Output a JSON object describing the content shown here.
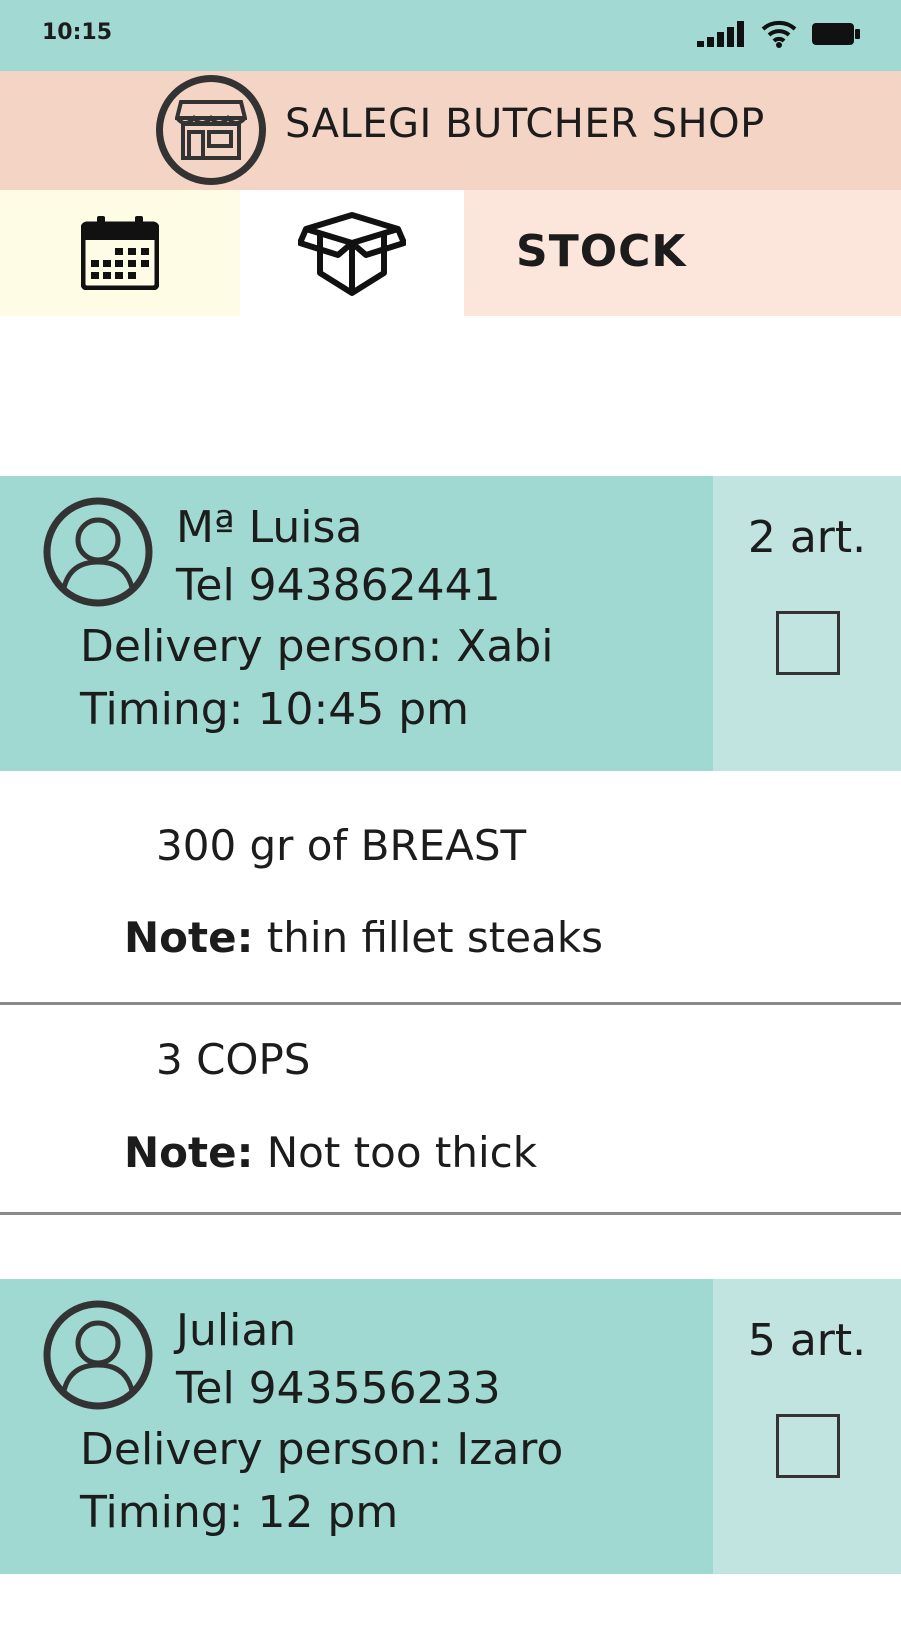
{
  "status_bar": {
    "time": "10:15",
    "icons": [
      "signal-icon",
      "wifi-icon",
      "battery-icon"
    ]
  },
  "header": {
    "title": "SALEGI BUTCHER SHOP",
    "logo_icon": "store-icon"
  },
  "tabs": {
    "calendar_icon": "calendar-icon",
    "box_icon": "box-icon",
    "stock_label": "STOCK"
  },
  "orders": [
    {
      "name": "Mª Luisa",
      "phone": "Tel 943862441",
      "delivery": "Delivery person: Xabi",
      "timing": "Timing: 10:45 pm",
      "articles": "2 art.",
      "checked": false,
      "items": [
        {
          "title": "300 gr of BREAST",
          "note_label": "Note:",
          "note": " thin fillet steaks"
        },
        {
          "title": "3 COPS",
          "note_label": "Note:",
          "note": " Not too thick"
        }
      ]
    },
    {
      "name": "Julian",
      "phone": "Tel 943556233",
      "delivery": "Delivery person: Izaro",
      "timing": "Timing: 12 pm",
      "articles": "5 art.",
      "checked": false,
      "items": []
    }
  ],
  "colors": {
    "status_bar": "#a3d9d3",
    "header": "#f4d5c5",
    "calendar_tab": "#fffce5",
    "stock_tab": "#fce5db",
    "order_main": "#a0d8d2",
    "order_side": "#c2e4e1"
  }
}
